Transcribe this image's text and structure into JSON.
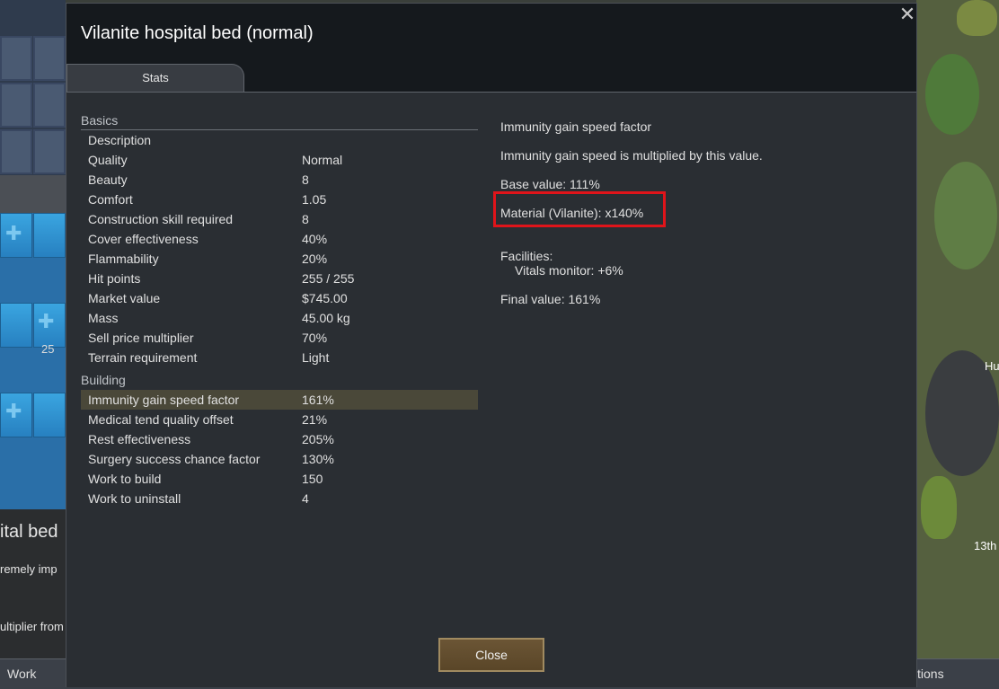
{
  "dialog": {
    "title": "Vilanite hospital bed (normal)",
    "close_icon": "close-icon",
    "tab_label": "Stats",
    "close_button_label": "Close"
  },
  "basics": {
    "header": "Basics",
    "rows": [
      {
        "label": "Description",
        "value": ""
      },
      {
        "label": "Quality",
        "value": "Normal"
      },
      {
        "label": "Beauty",
        "value": "8"
      },
      {
        "label": "Comfort",
        "value": "1.05"
      },
      {
        "label": "Construction skill required",
        "value": "8"
      },
      {
        "label": "Cover effectiveness",
        "value": "40%"
      },
      {
        "label": "Flammability",
        "value": "20%"
      },
      {
        "label": "Hit points",
        "value": "255 / 255"
      },
      {
        "label": "Market value",
        "value": "$745.00"
      },
      {
        "label": "Mass",
        "value": "45.00 kg"
      },
      {
        "label": "Sell price multiplier",
        "value": "70%"
      },
      {
        "label": "Terrain requirement",
        "value": "Light"
      }
    ]
  },
  "building": {
    "header": "Building",
    "rows": [
      {
        "label": "Immunity gain speed factor",
        "value": "161%"
      },
      {
        "label": "Medical tend quality offset",
        "value": "21%"
      },
      {
        "label": "Rest effectiveness",
        "value": "205%"
      },
      {
        "label": "Surgery success chance factor",
        "value": "130%"
      },
      {
        "label": "Work to build",
        "value": "150"
      },
      {
        "label": "Work to uninstall",
        "value": "4"
      }
    ]
  },
  "detail": {
    "title": "Immunity gain speed factor",
    "description": "Immunity gain speed is multiplied by this value.",
    "base_value": "Base value: 111%",
    "material": "Material (Vilanite): x140%",
    "facilities_header": "Facilities:",
    "facility_item": "Vitals monitor: +6%",
    "final_value": "Final value: 161%"
  },
  "background": {
    "left_stack_count": "25",
    "left_title": "ital bed",
    "left_line1": "remely imp",
    "left_line2": "ultiplier from",
    "right_label1": "Hu",
    "right_label2": "13th",
    "bottom_left_tab": "Work",
    "bottom_right_tab": "tions"
  },
  "colors": {
    "highlight_border": "#e0141a",
    "selected_row": "#4a4839",
    "panel_bg": "#2a2e33",
    "close_button": "#6b5535"
  }
}
